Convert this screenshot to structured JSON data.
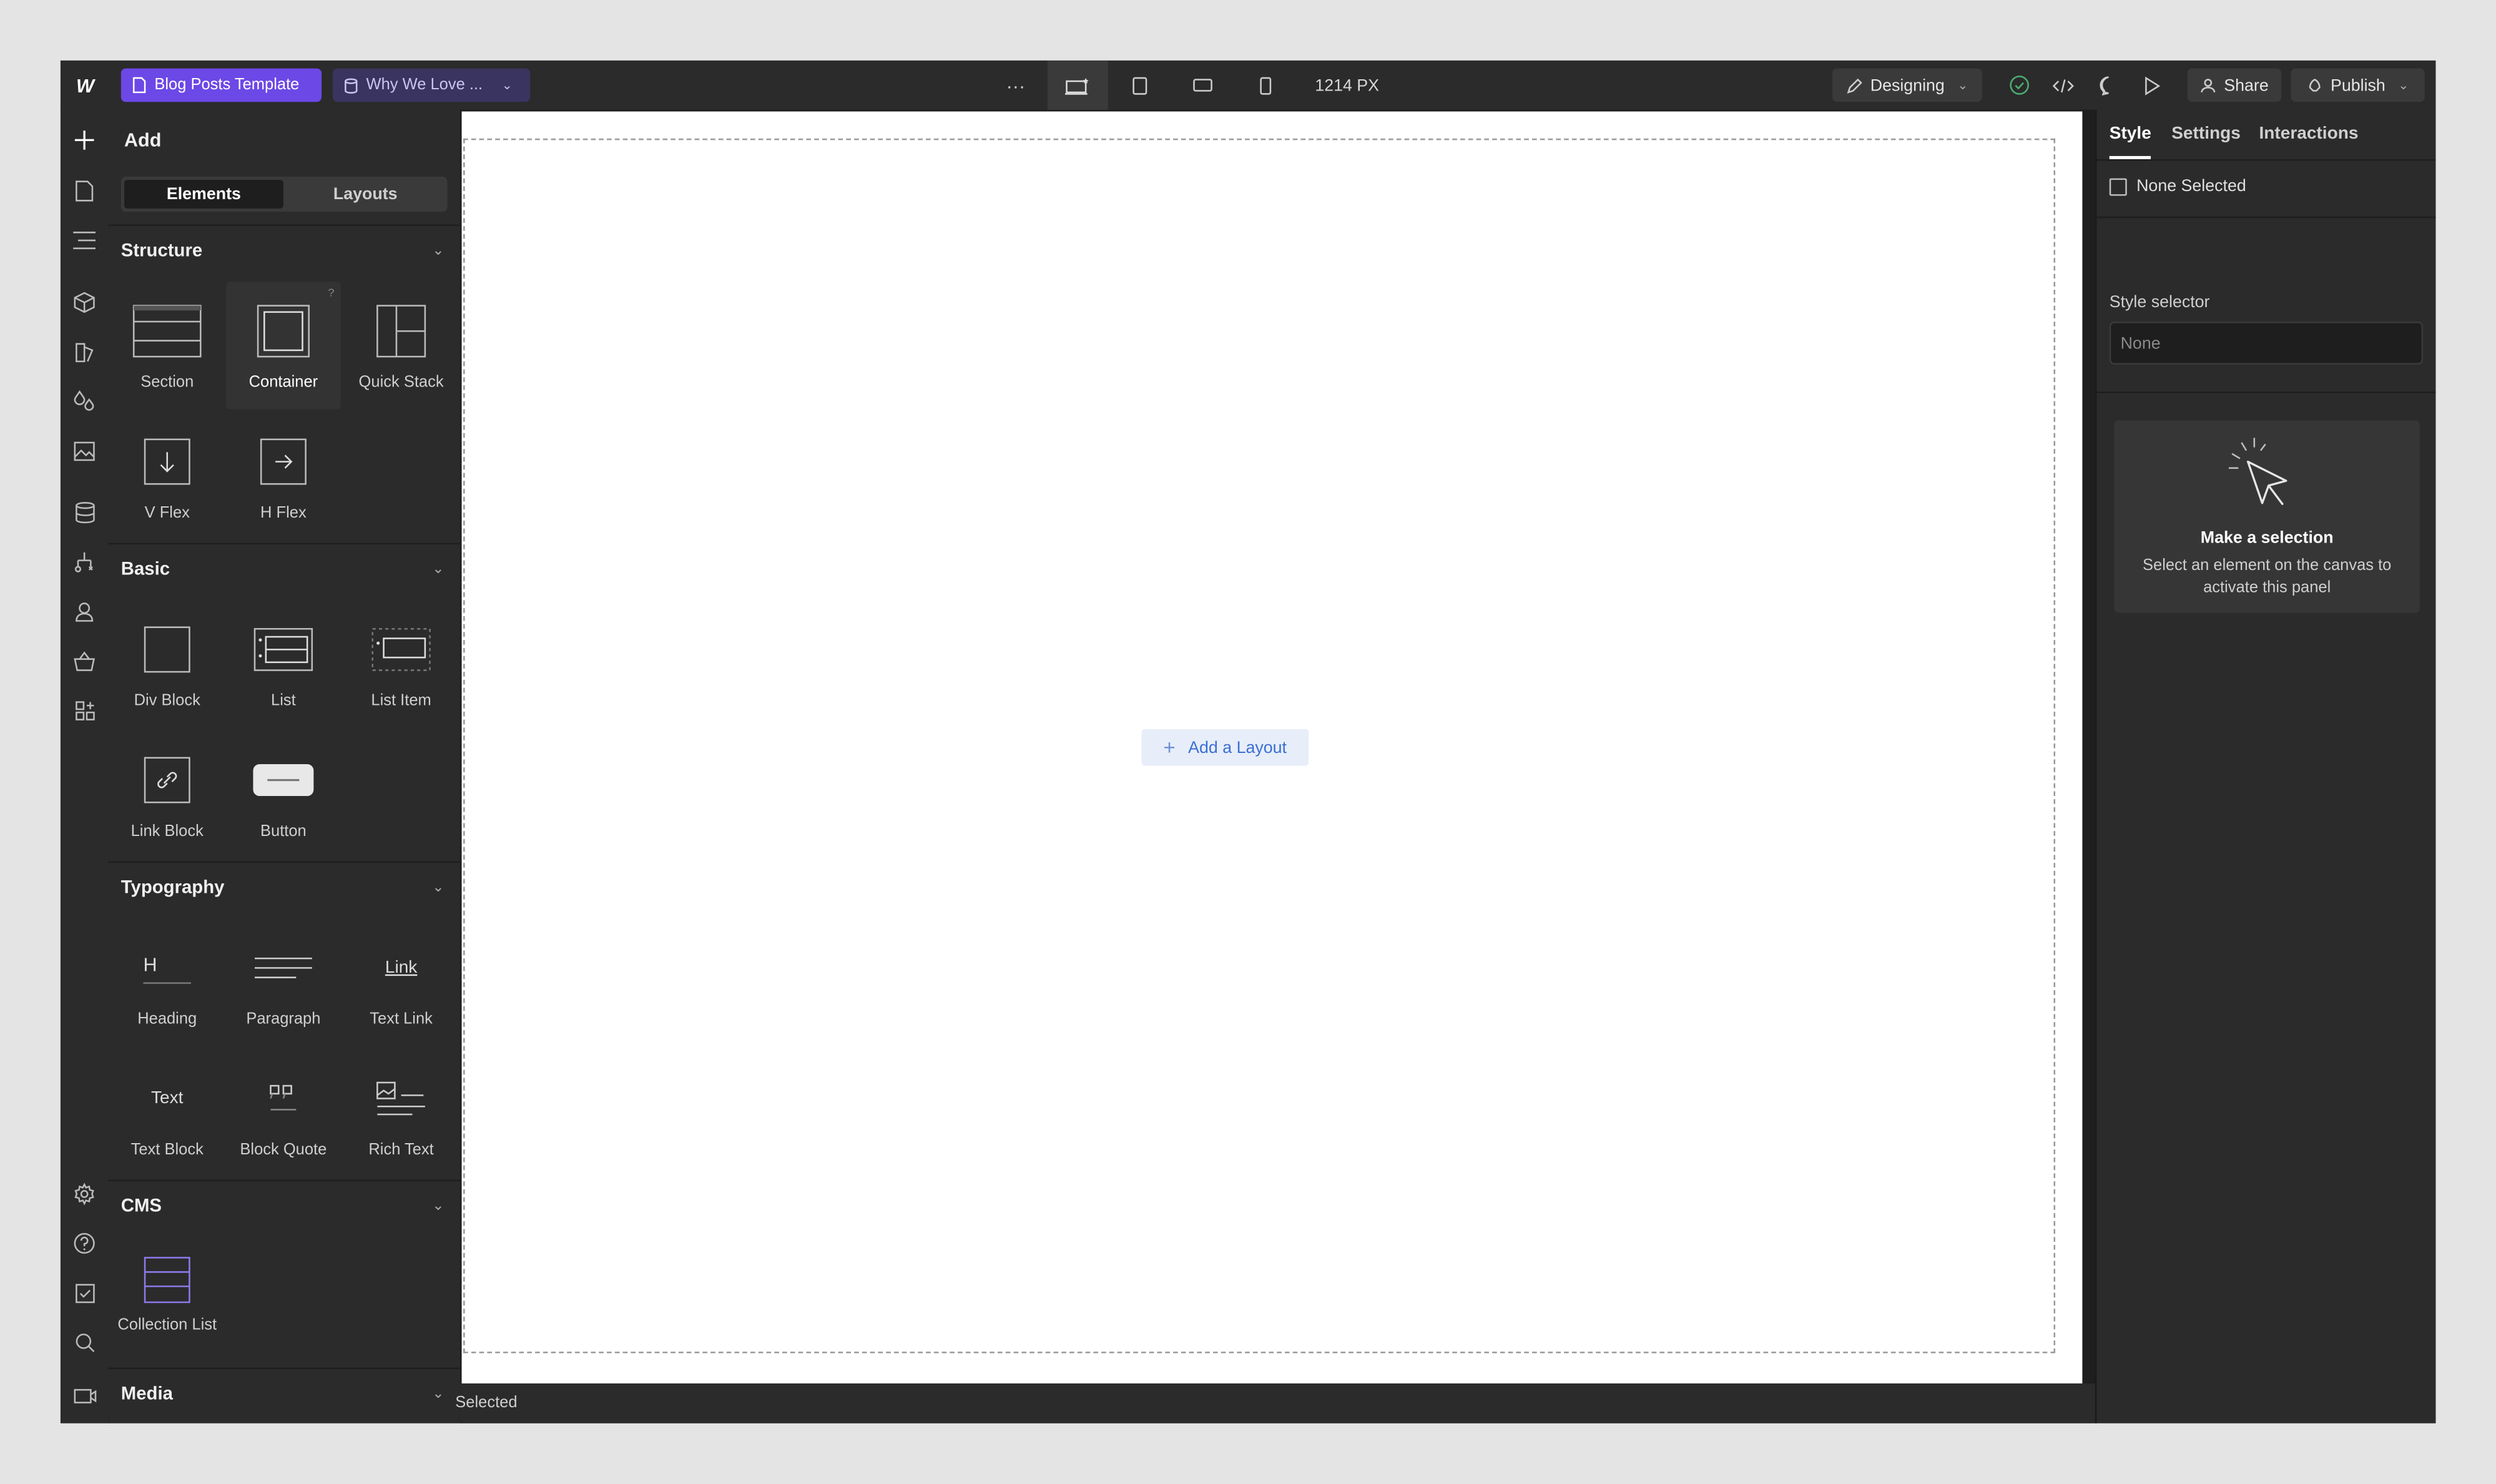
{
  "topbar": {
    "page_label": "Blog Posts Template",
    "collection_label": "Why We Love ...",
    "more": "···",
    "width_readout": "1214 PX",
    "mode_label": "Designing",
    "share_label": "Share",
    "publish_label": "Publish"
  },
  "add_panel": {
    "title": "Add",
    "tabs": {
      "elements": "Elements",
      "layouts": "Layouts"
    },
    "sections": {
      "structure": {
        "title": "Structure",
        "items": [
          "Section",
          "Container",
          "Quick Stack",
          "V Flex",
          "H Flex"
        ],
        "help": "?"
      },
      "basic": {
        "title": "Basic",
        "items": [
          "Div Block",
          "List",
          "List Item",
          "Link Block",
          "Button"
        ]
      },
      "typography": {
        "title": "Typography",
        "items": [
          "Heading",
          "Paragraph",
          "Text Link",
          "Text Block",
          "Block Quote",
          "Rich Text"
        ],
        "glyphs": {
          "heading": "H",
          "text_link": "Link",
          "text_block": "Text"
        }
      },
      "cms": {
        "title": "CMS",
        "items": [
          "Collection List"
        ]
      },
      "media": {
        "title": "Media"
      }
    }
  },
  "canvas": {
    "add_layout_label": "Add a Layout",
    "status_text": "Selected"
  },
  "right_panel": {
    "tabs": [
      "Style",
      "Settings",
      "Interactions"
    ],
    "none_selected": "None Selected",
    "style_selector_label": "Style selector",
    "style_selector_placeholder": "None",
    "selection_card": {
      "title": "Make a selection",
      "description": "Select an element on the canvas to activate this panel"
    }
  },
  "colors": {
    "accent": "#6c48e6",
    "panel": "#2b2b2b",
    "canvas": "#ffffff",
    "link_blue": "#3b6fd4"
  }
}
